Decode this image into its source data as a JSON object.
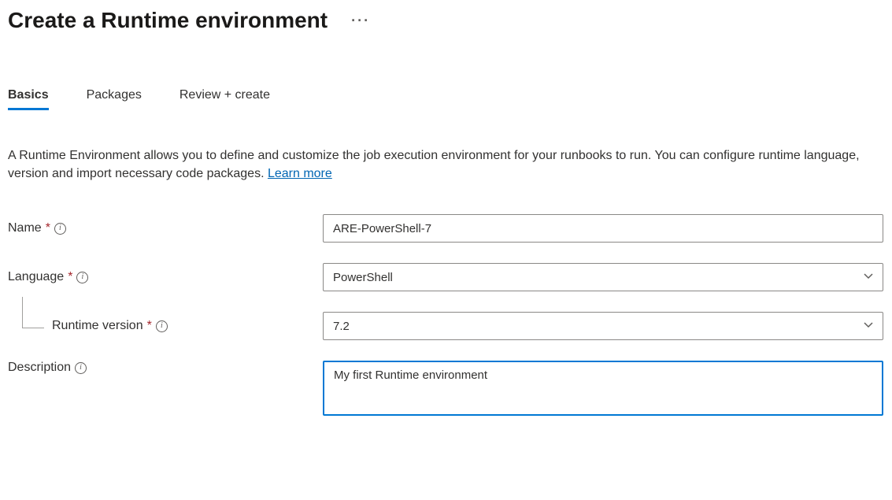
{
  "header": {
    "title": "Create a Runtime environment"
  },
  "tabs": [
    {
      "label": "Basics",
      "active": true
    },
    {
      "label": "Packages",
      "active": false
    },
    {
      "label": "Review + create",
      "active": false
    }
  ],
  "intro": {
    "text": "A Runtime Environment allows you to define and customize the job execution environment for your runbooks to run. You can configure runtime language, version and import necessary code packages. ",
    "learn_more": "Learn more"
  },
  "form": {
    "name": {
      "label": "Name",
      "value": "ARE-PowerShell-7"
    },
    "language": {
      "label": "Language",
      "value": "PowerShell"
    },
    "runtime_version": {
      "label": "Runtime version",
      "value": "7.2"
    },
    "description": {
      "label": "Description",
      "value": "My first Runtime environment"
    }
  }
}
